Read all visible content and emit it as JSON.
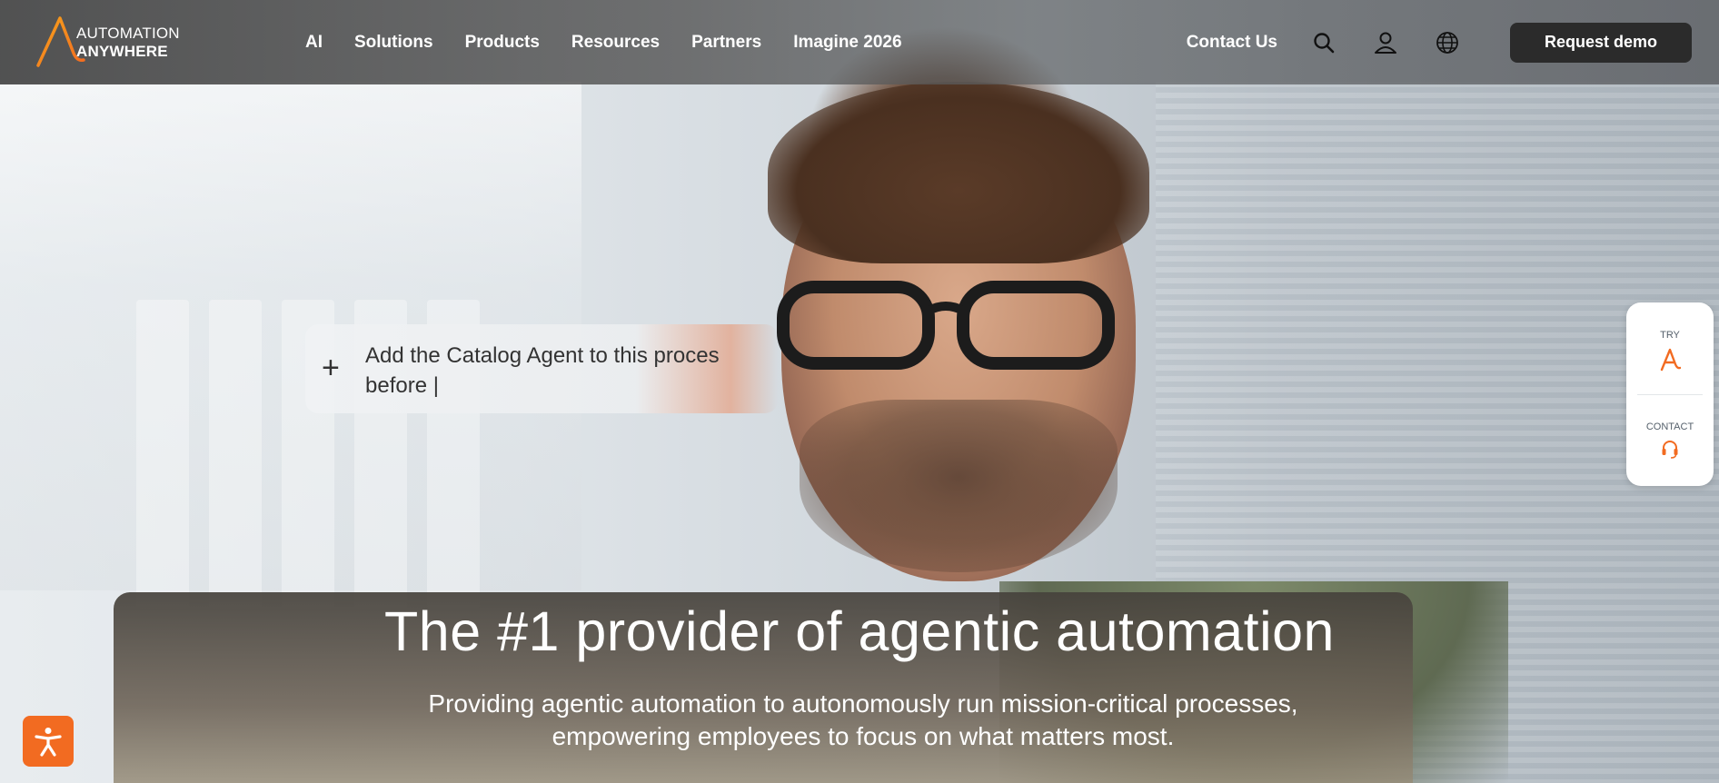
{
  "header": {
    "logo": {
      "line1": "AUTOMATION",
      "line2": "ANYWHERE"
    },
    "nav": [
      {
        "label": "AI"
      },
      {
        "label": "Solutions"
      },
      {
        "label": "Products"
      },
      {
        "label": "Resources"
      },
      {
        "label": "Partners"
      },
      {
        "label": "Imagine 2026"
      }
    ],
    "contact_label": "Contact Us",
    "search_icon": "search-icon",
    "account_icon": "user-icon",
    "language_icon": "globe-icon",
    "request_demo_label": "Request demo"
  },
  "prompt": {
    "plus_icon": "plus-icon",
    "text_line1": "Add the Catalog Agent to this proces",
    "text_line2": "before |"
  },
  "hero": {
    "title": "The #1 provider of agentic automation",
    "subtitle": "Providing agentic automation to autonomously run mission-critical processes, empowering employees to focus on what matters most."
  },
  "side_widget": {
    "try_label": "TRY",
    "try_icon": "automation-anywhere-logo-icon",
    "contact_label": "CONTACT",
    "contact_icon": "headset-icon"
  },
  "accessibility": {
    "icon": "accessibility-icon"
  },
  "colors": {
    "brand_orange": "#f26b21",
    "button_dark": "#2b2b2b"
  }
}
